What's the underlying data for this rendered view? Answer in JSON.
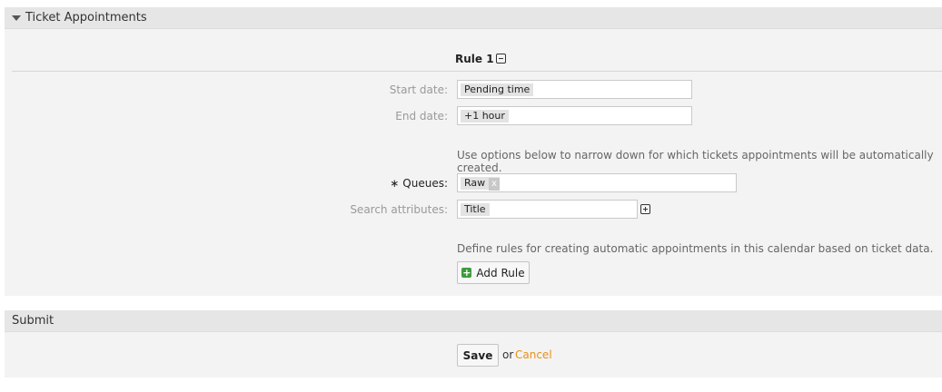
{
  "ticket_appointments": {
    "header": "Ticket Appointments",
    "rule_title": "Rule 1",
    "start_date_label": "Start date:",
    "start_date_value": "Pending time",
    "end_date_label": "End date:",
    "end_date_value": "+1 hour",
    "narrow_note": "Use options below to narrow down for which tickets appointments will be automatically created.",
    "queues_label": "Queues:",
    "queues_required_mark": "∗",
    "queues_value": "Raw",
    "queues_remove": "x",
    "search_attributes_label": "Search attributes:",
    "search_attributes_value": "Title",
    "define_note": "Define rules for creating automatic appointments in this calendar based on ticket data.",
    "add_rule_label": "Add Rule"
  },
  "submit": {
    "header": "Submit",
    "save_label": "Save",
    "or_text": "or",
    "cancel_label": "Cancel"
  },
  "colors": {
    "link": "#e8901b",
    "add_icon": "#3b9c3b"
  },
  "icons": [
    "caret-down-icon",
    "collapse-minus-icon",
    "add-attribute-plus-icon",
    "add-rule-plus-icon",
    "remove-tag-icon"
  ]
}
